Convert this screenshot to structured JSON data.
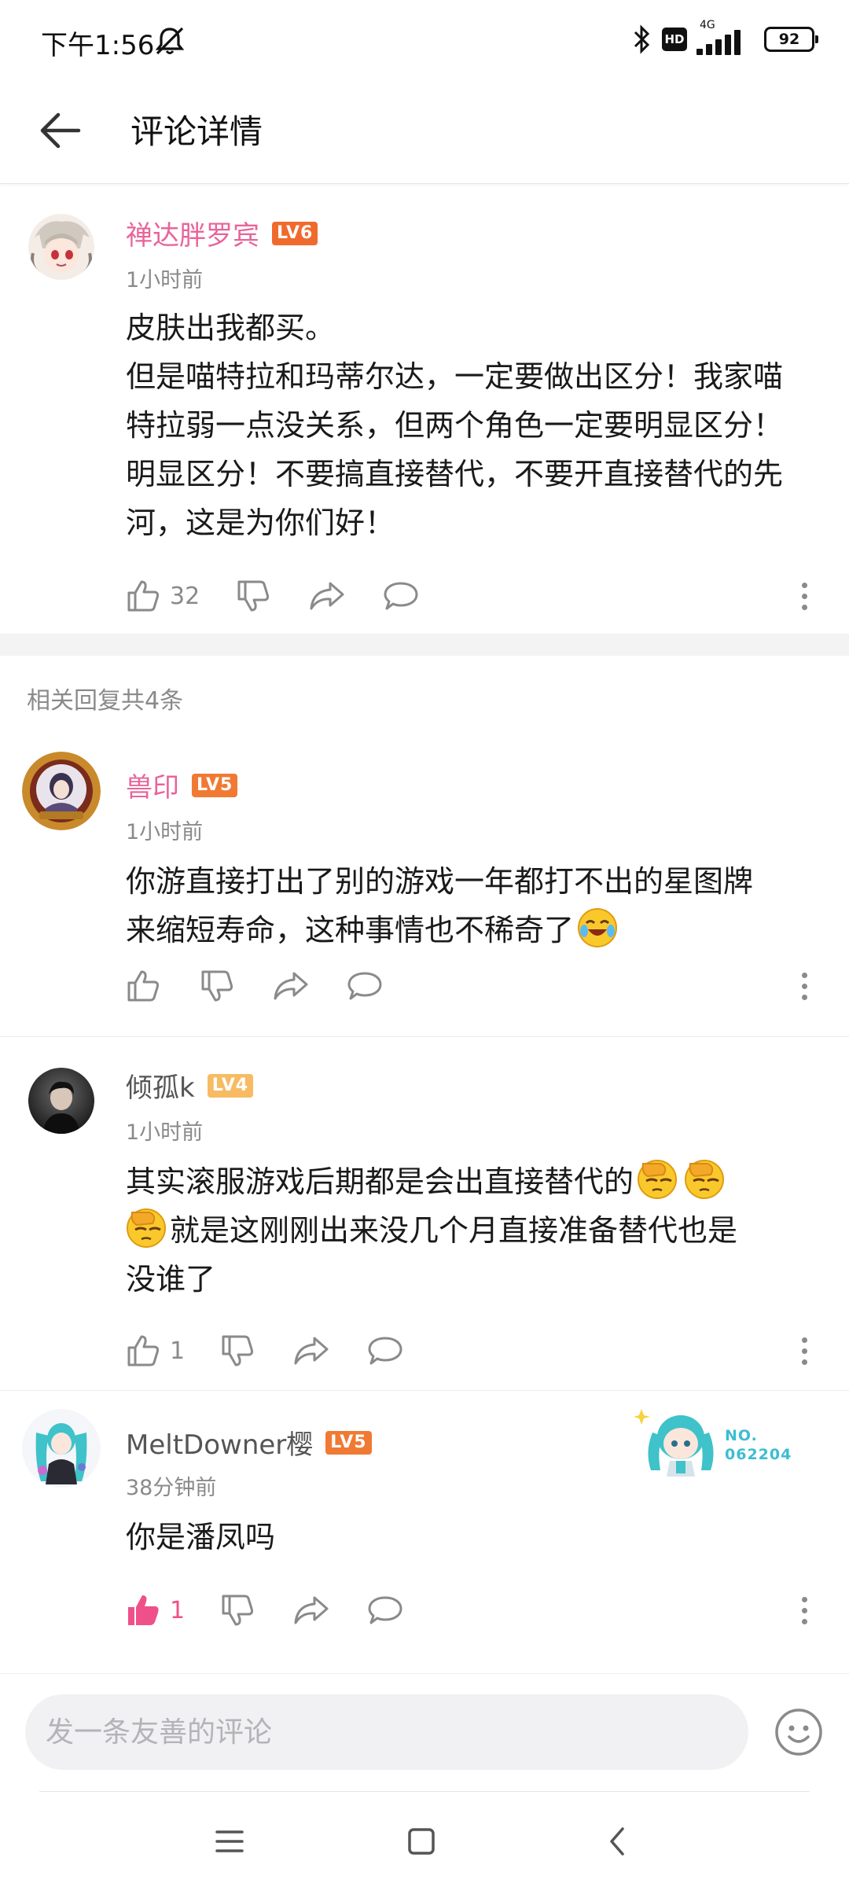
{
  "status_bar": {
    "time": "下午1:56",
    "network": "4G",
    "hd": "HD",
    "battery": "92"
  },
  "header": {
    "title": "评论详情",
    "back_icon": "arrow-left-icon"
  },
  "main_comment": {
    "username": "禅达胖罗宾",
    "level": "LV6",
    "time": "1小时前",
    "text_lines": [
      "皮肤出我都买。",
      "但是喵特拉和玛蒂尔达，一定要做出区分！我家喵",
      "特拉弱一点没关系，但两个角色一定要明显区分！",
      "明显区分！不要搞直接替代，不要开直接替代的先",
      "河，这是为你们好！"
    ],
    "like_count": "32"
  },
  "replies_header": "相关回复共4条",
  "replies": [
    {
      "username": "兽印",
      "level": "LV5",
      "time": "1小时前",
      "text_line1": "你游直接打出了别的游戏一年都打不出的星图牌",
      "text_line2": "来缩短寿命，这种事情也不稀奇了",
      "like_count": ""
    },
    {
      "username": "倾孤k",
      "level": "LV4",
      "time": "1小时前",
      "text_line1": "其实滚服游戏后期都是会出直接替代的",
      "text_line2": "就是这刚刚出来没几个月直接准备替代也是",
      "text_line3": "没谁了",
      "like_count": "1"
    },
    {
      "username": "MeltDowner樱",
      "level": "LV5",
      "time": "38分钟前",
      "text_line1": "你是潘凤吗",
      "like_count": "1",
      "fan_no_label": "NO.",
      "fan_no_value": "062204"
    }
  ],
  "input": {
    "placeholder": "发一条友善的评论"
  },
  "colors": {
    "pink_name": "#e8649a",
    "gray_name": "#555555",
    "lv6": "#f06a2e",
    "lv5": "#f07a33",
    "lv4": "#f7bb63",
    "liked": "#f0508a",
    "icon_gray": "#8a8a8a"
  }
}
